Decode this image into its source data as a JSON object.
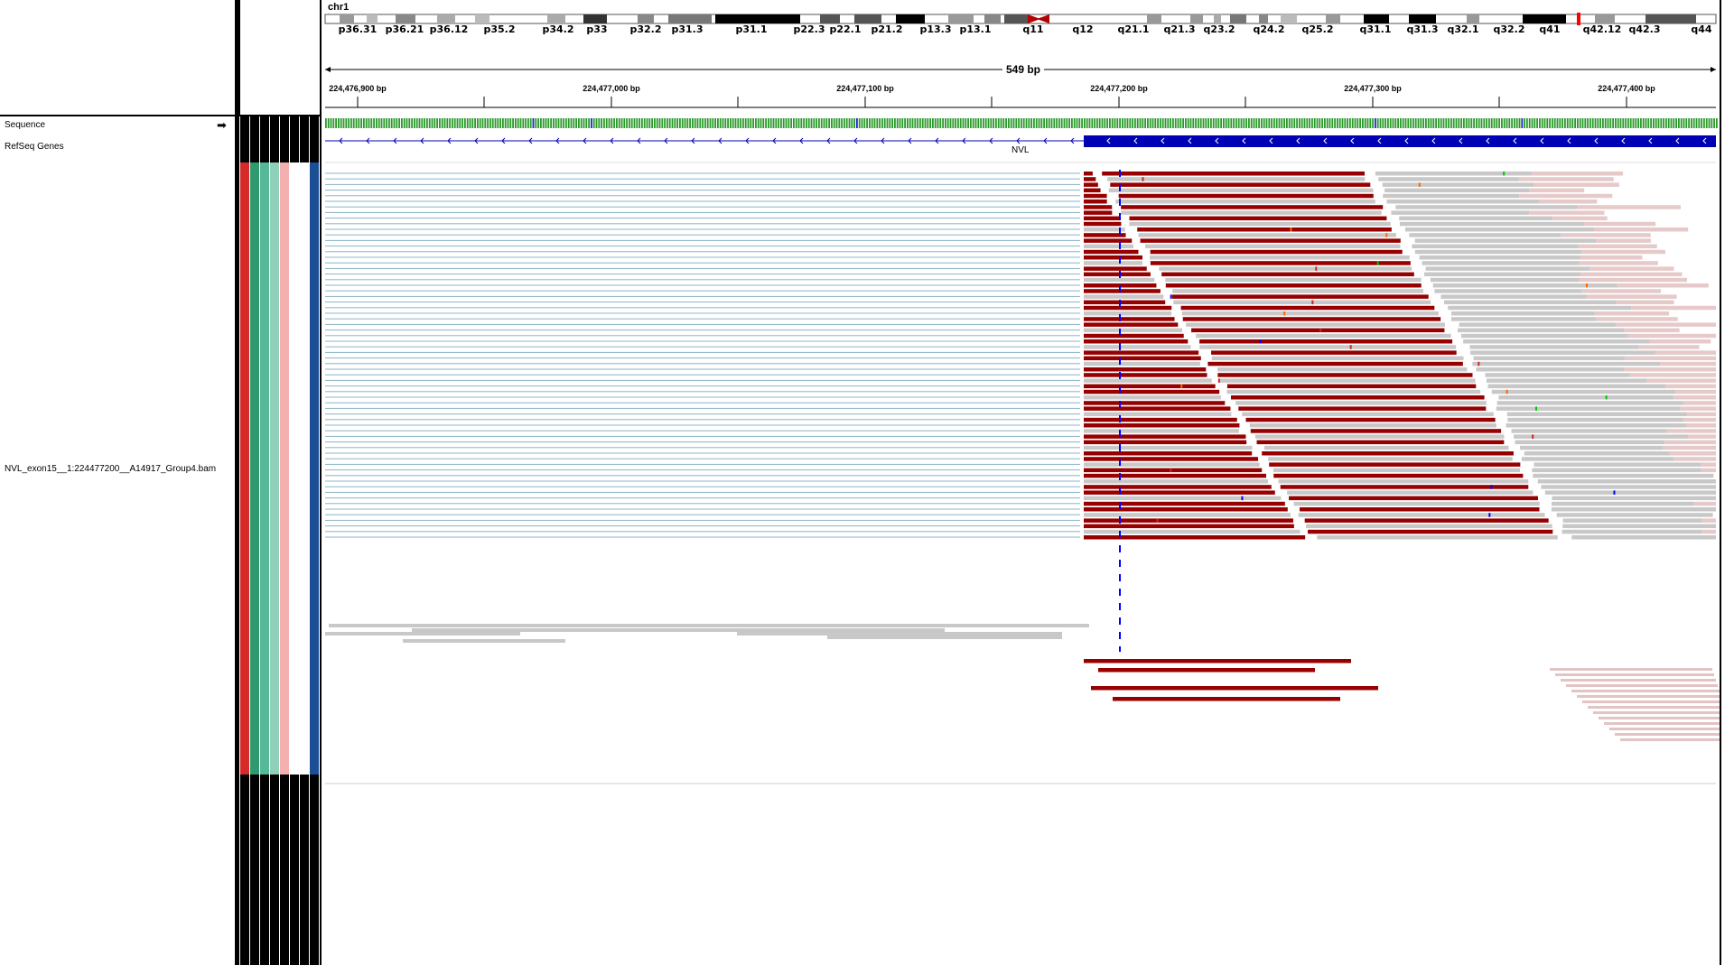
{
  "chromosome": {
    "name": "chr1",
    "bands": [
      "p36.31",
      "p36.21",
      "p36.12",
      "p35.2",
      "p34.2",
      "p33",
      "p32.2",
      "p31.3",
      "p31.1",
      "p22.3",
      "p22.1",
      "p21.2",
      "p13.3",
      "p13.1",
      "q11",
      "q12",
      "q21.1",
      "q21.3",
      "q23.2",
      "q24.2",
      "q25.2",
      "q31.1",
      "q31.3",
      "q32.1",
      "q32.2",
      "q41",
      "q42.12",
      "q42.3",
      "q44"
    ]
  },
  "ruler": {
    "span_label": "549 bp",
    "ticks": [
      "224,476,900 bp",
      "224,477,000 bp",
      "224,477,100 bp",
      "224,477,200 bp",
      "224,477,300 bp",
      "224,477,400 bp"
    ]
  },
  "tracks": {
    "sequence": "Sequence",
    "refseq": "RefSeq Genes",
    "gene_name": "NVL",
    "bam": "NVL_exon15__1:224477200__A14917_Group4.bam"
  },
  "attributes": {
    "colors": [
      "#d42a2a",
      "#2e9a6e",
      "#55b896",
      "#8fd0b8",
      "#f4b0b0",
      "#ffffff",
      "#ffffff",
      "#1a4f96"
    ]
  },
  "colors": {
    "exon": "#0000b4",
    "read_red": "#960000",
    "read_gray": "#c8c8c8",
    "softclip": "#dcb4b4",
    "insert_line": "#8cb4c8",
    "center_line": "#0000ff"
  }
}
